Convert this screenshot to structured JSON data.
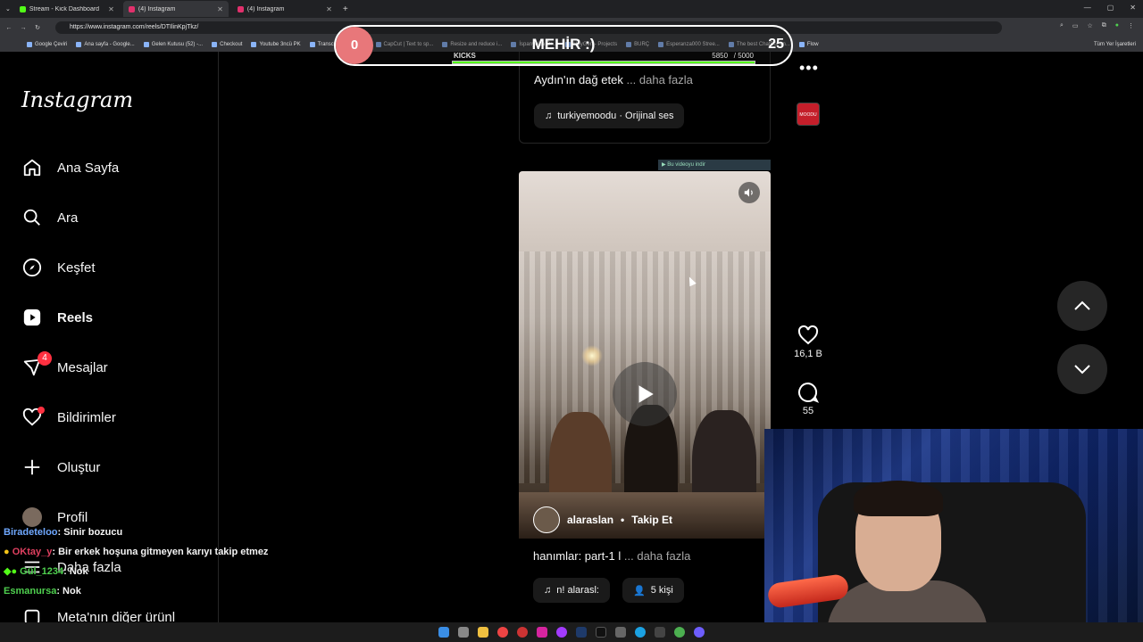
{
  "browser": {
    "tabs": [
      {
        "title": "Stream - Kick Dashboard",
        "color": "#53fc18",
        "active": false
      },
      {
        "title": "(4) Instagram",
        "color": "#e1306c",
        "active": true
      },
      {
        "title": "(4) Instagram",
        "color": "#e1306c",
        "active": false
      }
    ],
    "new_tab": "+",
    "url": "https://www.instagram.com/reels/DTIlinKpjTkz/",
    "bookmarks": [
      "Google Çeviri",
      "Ana sayfa - Google...",
      "Gelen Kutusu (52) -...",
      "Checkout",
      "Youtube 3ncü PK",
      "Transcript of \"Mi M...",
      "CapCut | Text to sp...",
      "Resize and reduce i...",
      "İspanyolca Ör...",
      "HeyGen - Projects",
      "BURÇ",
      "Esperanza000 Stree...",
      "The best ChatBot an...",
      "Flow"
    ],
    "bookmarks_right": "Tüm Yer İşaretleri"
  },
  "kick_overlay": {
    "left_score": "0",
    "title": "MEHİR :)",
    "right_score": "25",
    "label": "KICKS",
    "count": "5850",
    "target": "/ 5000",
    "progress": 1.0
  },
  "sidebar": {
    "logo": "Instagram",
    "items": [
      {
        "label": "Ana Sayfa",
        "icon": "home-icon"
      },
      {
        "label": "Ara",
        "icon": "search-icon"
      },
      {
        "label": "Keşfet",
        "icon": "compass-icon"
      },
      {
        "label": "Reels",
        "icon": "reels-icon"
      },
      {
        "label": "Mesajlar",
        "icon": "messenger-icon",
        "badge": "4"
      },
      {
        "label": "Bildirimler",
        "icon": "heart-icon"
      },
      {
        "label": "Oluştur",
        "icon": "plus-icon"
      },
      {
        "label": "Profil",
        "icon": "avatar"
      },
      {
        "label": "Daha fazla",
        "icon": "menu-icon"
      },
      {
        "label": "Meta'nın diğer ürünl",
        "icon": "meta-icon"
      }
    ]
  },
  "chat": [
    {
      "user": "Biradeteloo",
      "msg": ": Sinir bozucu"
    },
    {
      "user": "OKtay_y",
      "msg": ": Bir erkek hoşuna gitmeyen karıyı takip etmez"
    },
    {
      "user": "Gül_1234",
      "msg": ": Nok"
    },
    {
      "user": "Esmanursa",
      "msg": ": Nok"
    }
  ],
  "prev_reel": {
    "caption": "Aydın'ın dağ etek",
    "more": "... daha fazla",
    "audio": "turkiyemoodu · Orijinal ses"
  },
  "reel": {
    "download_label": "▶ Bu videoyu indir",
    "author": "alaraslan",
    "follow": "Takip Et",
    "caption": "hanımlar: part-1 l",
    "more": "... daha fazla",
    "audio": "n!  alarasl:",
    "people": "5 kişi"
  },
  "actions": {
    "likes": "16,1 B",
    "comments": "55",
    "audio_thumb": "MOODU"
  },
  "colors": {
    "background": "#000000",
    "kick_green": "#53fc18",
    "badge_red": "#ff3040"
  }
}
